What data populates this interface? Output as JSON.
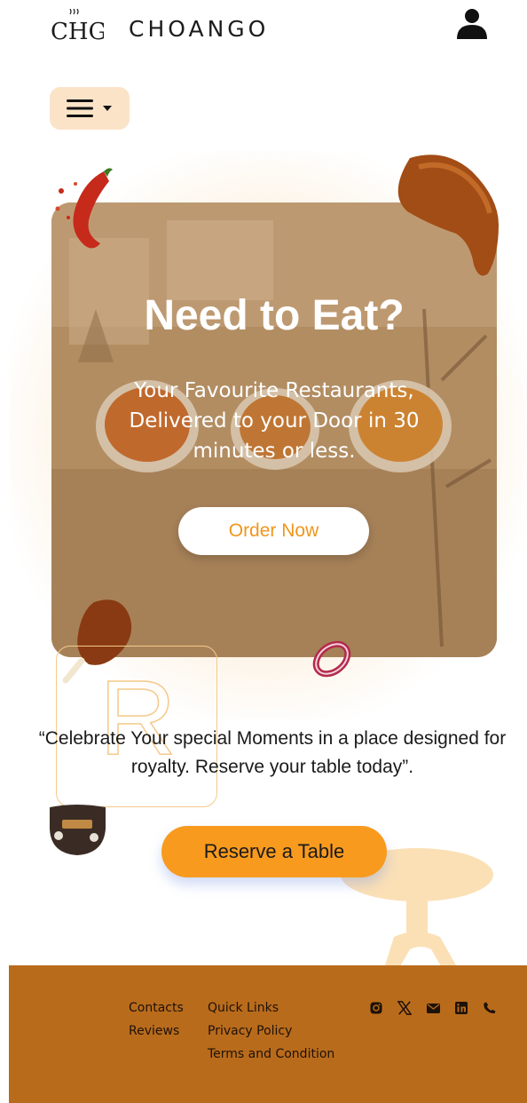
{
  "header": {
    "brand_name": "CHOANGO",
    "logo_text": "CHG"
  },
  "menu": {
    "icon": "hamburger-menu-icon",
    "caret_icon": "caret-down-icon"
  },
  "hero": {
    "title": "Need to Eat?",
    "subtitle": "Your Favourite Restaurants, Delivered to your Door in 30 minutes or less.",
    "cta_label": "Order Now"
  },
  "quote": {
    "text": "“Celebrate Your special Moments in a place designed for royalty. Reserve your  table today”.",
    "decor_letter": "R"
  },
  "reserve": {
    "cta_label": "Reserve a Table"
  },
  "footer": {
    "col1": [
      "Contacts",
      "Reviews"
    ],
    "col2": [
      "Quick Links",
      "Privacy Policy",
      "Terms and Condition"
    ],
    "social_icons": [
      "instagram-icon",
      "x-twitter-icon",
      "mail-icon",
      "linkedin-icon",
      "phone-icon"
    ]
  },
  "colors": {
    "accent_orange": "#f89a1e",
    "menu_bg": "#fbe3c8",
    "footer_bg": "#b96b1c",
    "order_text": "#f0961c"
  }
}
